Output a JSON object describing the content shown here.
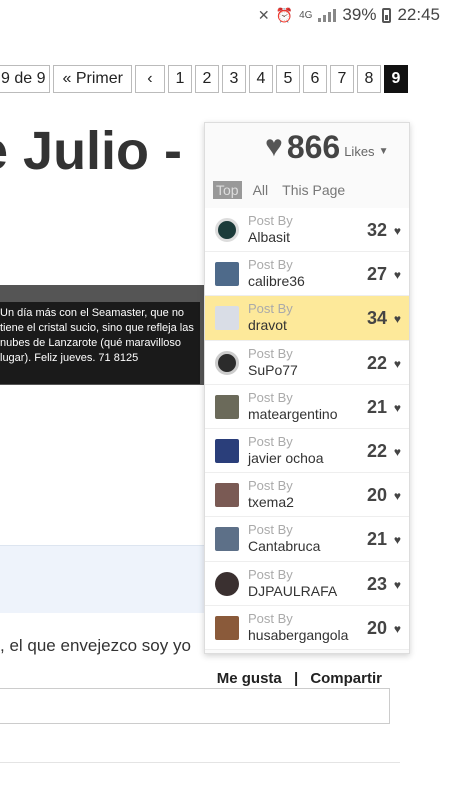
{
  "status_bar": {
    "battery": "39%",
    "time": "22:45",
    "network": "4G"
  },
  "pager": {
    "position": "9 de 9",
    "first_label": "« Primer",
    "prev_label": "‹",
    "pages": [
      "1",
      "2",
      "3",
      "4",
      "5",
      "6",
      "7",
      "8",
      "9"
    ],
    "current": "9"
  },
  "page": {
    "title": "e Julio -",
    "caption": "Un día más con el Seamaster, que no tiene el cristal sucio, sino que refleja las nubes de Lanzarote (qué maravilloso lugar). Feliz jueves. 71 8125",
    "body_text": ", el que envejezco soy yo",
    "like_label": "Me gusta",
    "separator": "|",
    "share_label": "Compartir"
  },
  "likes": {
    "count": "866",
    "label": "Likes",
    "tabs": [
      "Top",
      "All",
      "This Page"
    ],
    "active_tab": "Top",
    "post_by_label": "Post By",
    "rows": [
      {
        "user": "Albasit",
        "score": "32",
        "avatar_color": "#1c3b3a"
      },
      {
        "user": "calibre36",
        "score": "27",
        "avatar_color": "#4e6a8a"
      },
      {
        "user": "dravot",
        "score": "34",
        "avatar_color": "#d9dde6"
      },
      {
        "user": "SuPo77",
        "score": "22",
        "avatar_color": "#2b2b2b"
      },
      {
        "user": "mateargentino",
        "score": "21",
        "avatar_color": "#6b6a5a"
      },
      {
        "user": "javier ochoa",
        "score": "22",
        "avatar_color": "#2a3e7a"
      },
      {
        "user": "txema2",
        "score": "20",
        "avatar_color": "#7a5a54"
      },
      {
        "user": "Cantabruca",
        "score": "21",
        "avatar_color": "#5d7088"
      },
      {
        "user": "DJPAULRAFA",
        "score": "23",
        "avatar_color": "#3a3030"
      },
      {
        "user": "husabergangola",
        "score": "20",
        "avatar_color": "#8a5a3a"
      }
    ],
    "highlight_color": "#fde99a"
  }
}
